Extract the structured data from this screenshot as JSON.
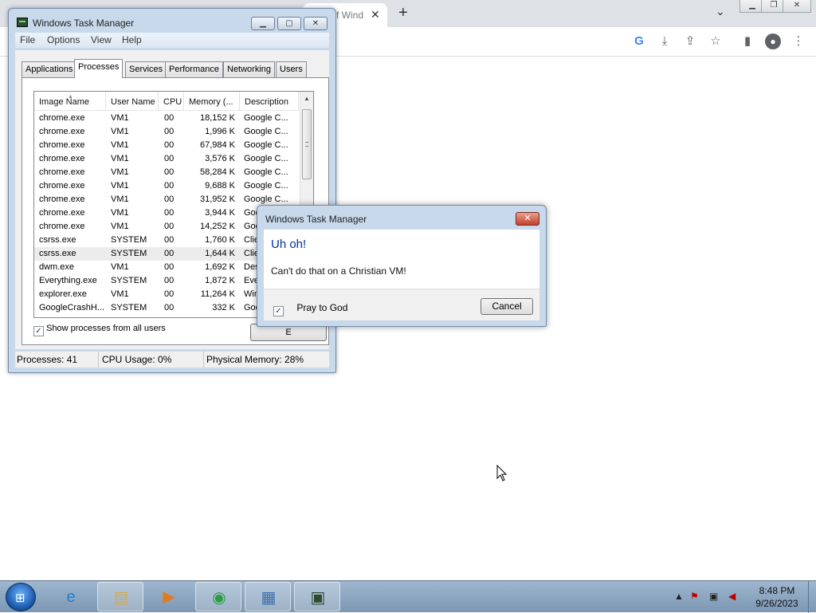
{
  "browser": {
    "tab_title": "f Wind",
    "tab_close": "✕",
    "new_tab": "+",
    "tab_search": "⌄",
    "toolbar_icons": [
      "google-icon",
      "download-icon",
      "share-icon",
      "star-icon",
      "side-panel-icon",
      "profile-icon",
      "menu-icon"
    ]
  },
  "task_manager": {
    "title": "Windows Task Manager",
    "menu": [
      "File",
      "Options",
      "View",
      "Help"
    ],
    "tabs": [
      "Applications",
      "Processes",
      "Services",
      "Performance",
      "Networking",
      "Users"
    ],
    "active_tab": "Processes",
    "columns": [
      "Image Name",
      "User Name",
      "CPU",
      "Memory (...",
      "Description"
    ],
    "processes": [
      {
        "name": "chrome.exe",
        "user": "VM1",
        "cpu": "00",
        "mem": "18,152 K",
        "desc": "Google C..."
      },
      {
        "name": "chrome.exe",
        "user": "VM1",
        "cpu": "00",
        "mem": "1,996 K",
        "desc": "Google C..."
      },
      {
        "name": "chrome.exe",
        "user": "VM1",
        "cpu": "00",
        "mem": "67,984 K",
        "desc": "Google C..."
      },
      {
        "name": "chrome.exe",
        "user": "VM1",
        "cpu": "00",
        "mem": "3,576 K",
        "desc": "Google C..."
      },
      {
        "name": "chrome.exe",
        "user": "VM1",
        "cpu": "00",
        "mem": "58,284 K",
        "desc": "Google C..."
      },
      {
        "name": "chrome.exe",
        "user": "VM1",
        "cpu": "00",
        "mem": "9,688 K",
        "desc": "Google C..."
      },
      {
        "name": "chrome.exe",
        "user": "VM1",
        "cpu": "00",
        "mem": "31,952 K",
        "desc": "Google C..."
      },
      {
        "name": "chrome.exe",
        "user": "VM1",
        "cpu": "00",
        "mem": "3,944 K",
        "desc": "Google C..."
      },
      {
        "name": "chrome.exe",
        "user": "VM1",
        "cpu": "00",
        "mem": "14,252 K",
        "desc": "Goo"
      },
      {
        "name": "csrss.exe",
        "user": "SYSTEM",
        "cpu": "00",
        "mem": "1,760 K",
        "desc": "Clie"
      },
      {
        "name": "csrss.exe",
        "user": "SYSTEM",
        "cpu": "00",
        "mem": "1,644 K",
        "desc": "Clie"
      },
      {
        "name": "dwm.exe",
        "user": "VM1",
        "cpu": "00",
        "mem": "1,692 K",
        "desc": "Des"
      },
      {
        "name": "Everything.exe",
        "user": "SYSTEM",
        "cpu": "00",
        "mem": "1,872 K",
        "desc": "Eve"
      },
      {
        "name": "explorer.exe",
        "user": "VM1",
        "cpu": "00",
        "mem": "11,264 K",
        "desc": "Win"
      },
      {
        "name": "GoogleCrashH...",
        "user": "SYSTEM",
        "cpu": "00",
        "mem": "332 K",
        "desc": "Goo"
      }
    ],
    "selected_index": 10,
    "show_all_label": "Show processes from all users",
    "show_all_checked": "✓",
    "end_button": "E",
    "status": {
      "processes": "Processes: 41",
      "cpu": "CPU Usage: 0%",
      "memory": "Physical Memory: 28%"
    }
  },
  "dialog": {
    "title": "Windows Task Manager",
    "close": "✕",
    "heading": "Uh oh!",
    "message": "Can't do that on a Christian VM!",
    "checkbox_label": "Pray to God",
    "checkbox_checked": "✓",
    "cancel": "Cancel"
  },
  "taskbar": {
    "start": "⊞",
    "apps": [
      {
        "name": "internet-explorer-icon",
        "glyph": "e",
        "color": "#1e7fd8",
        "running": false
      },
      {
        "name": "file-explorer-icon",
        "glyph": "▤",
        "color": "#d9a845",
        "running": true
      },
      {
        "name": "media-player-icon",
        "glyph": "▶",
        "color": "#e07b22",
        "running": false
      },
      {
        "name": "chrome-icon",
        "glyph": "◉",
        "color": "#2e9b45",
        "running": true
      },
      {
        "name": "control-panel-icon",
        "glyph": "▦",
        "color": "#3a6fb0",
        "running": true
      },
      {
        "name": "task-manager-icon",
        "glyph": "▣",
        "color": "#2d4b2f",
        "running": true
      }
    ],
    "time": "8:48 PM",
    "date": "9/26/2023"
  }
}
